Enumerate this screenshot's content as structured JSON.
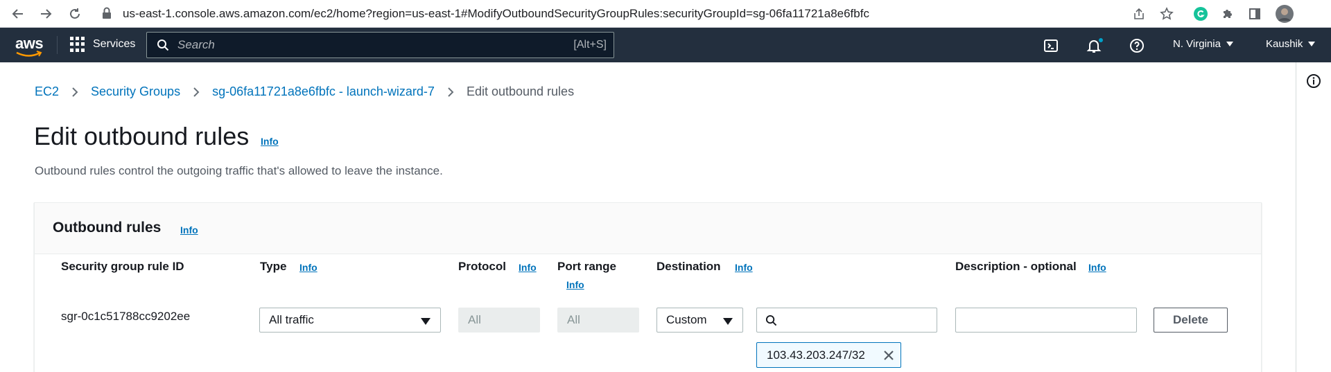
{
  "browser": {
    "url": "us-east-1.console.aws.amazon.com/ec2/home?region=us-east-1#ModifyOutboundSecurityGroupRules:securityGroupId=sg-06fa11721a8e6fbfc"
  },
  "topnav": {
    "logo": "aws",
    "services_label": "Services",
    "search_placeholder": "Search",
    "search_shortcut": "[Alt+S]",
    "region": "N. Virginia",
    "user": "Kaushik"
  },
  "breadcrumb": {
    "items": [
      "EC2",
      "Security Groups",
      "sg-06fa11721a8e6fbfc - launch-wizard-7"
    ],
    "current": "Edit outbound rules"
  },
  "page": {
    "title": "Edit outbound rules",
    "info": "Info",
    "description": "Outbound rules control the outgoing traffic that's allowed to leave the instance."
  },
  "panel": {
    "title": "Outbound rules",
    "info": "Info",
    "columns": {
      "rule_id": "Security group rule ID",
      "type": "Type",
      "protocol": "Protocol",
      "port_range": "Port range",
      "destination": "Destination",
      "description": "Description - optional"
    },
    "info_label": "Info",
    "row": {
      "rule_id": "sgr-0c1c51788cc9202ee",
      "type": "All traffic",
      "protocol": "All",
      "port_range": "All",
      "destination_type": "Custom",
      "destination_value": "",
      "description": "",
      "delete_label": "Delete",
      "token": "103.43.203.247/32"
    }
  },
  "colors": {
    "nav_bg": "#232f3e",
    "link": "#0073bb",
    "token_bg": "#f1faff",
    "notification_dot": "#00a1c9"
  }
}
